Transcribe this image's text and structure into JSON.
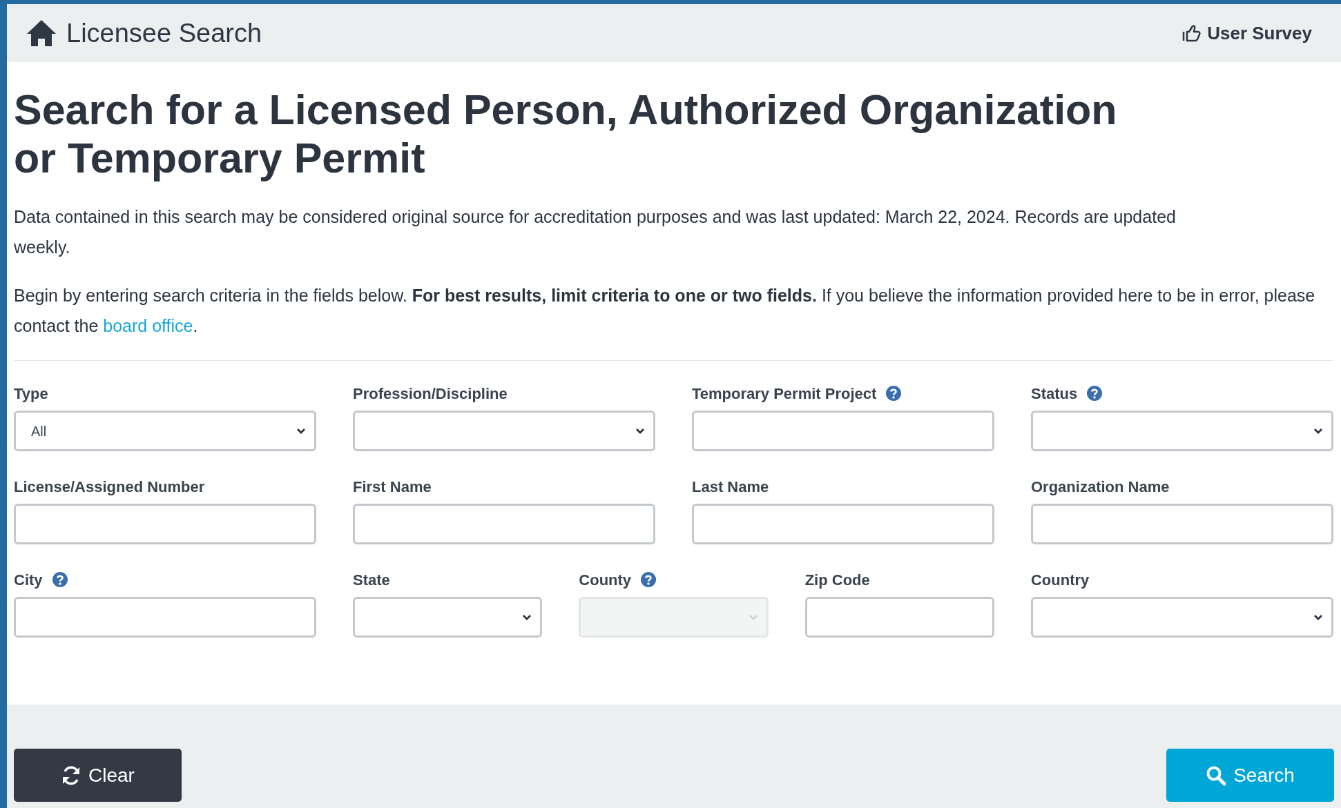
{
  "header": {
    "title": "Licensee Search",
    "survey_link": "User Survey"
  },
  "heading": "Search for a Licensed Person, Authorized Organization or Temporary Permit",
  "notice": "Data contained in this search may be considered original source for accreditation purposes and was last updated: March 22, 2024. Records are updated weekly.",
  "instructions": {
    "text": "Begin by entering search criteria in the fields below. **For best results, limit criteria to one or two fields.** If you believe the information provided here to be in error, please contact the",
    "link": "board office",
    "after": "."
  },
  "form_rows": [
    [
      {
        "label": "Type",
        "kind": "select",
        "value": "All",
        "help": false,
        "disabled": false
      },
      {
        "label": "Profession/Discipline",
        "kind": "select",
        "help": false,
        "disabled": false
      },
      {
        "label": "Temporary Permit Project",
        "kind": "input",
        "help": true,
        "disabled": false
      },
      {
        "label": "Status",
        "kind": "select",
        "help": true,
        "disabled": false
      }
    ],
    [
      {
        "label": "License/Assigned Number",
        "kind": "input",
        "help": false,
        "disabled": false
      },
      {
        "label": "First Name",
        "kind": "input",
        "help": false,
        "disabled": false
      },
      {
        "label": "Last Name",
        "kind": "input",
        "help": false,
        "disabled": false
      },
      {
        "label": "Organization Name",
        "kind": "input",
        "help": false,
        "disabled": false
      }
    ],
    [
      {
        "label": "City",
        "kind": "input",
        "help": true,
        "disabled": false
      },
      {
        "label": "State",
        "kind": "select",
        "help": false,
        "disabled": false
      },
      {
        "label": "County",
        "kind": "select",
        "help": true,
        "disabled": true
      },
      {
        "label": "Zip Code",
        "kind": "input",
        "help": false,
        "disabled": false
      },
      {
        "label": "Country",
        "kind": "select",
        "help": false,
        "disabled": false
      }
    ]
  ],
  "buttons": {
    "clear": "Clear",
    "search": "Search"
  }
}
